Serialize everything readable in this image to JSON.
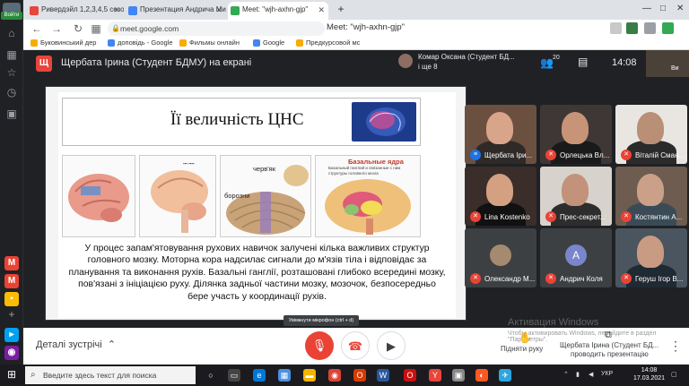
{
  "browser": {
    "login_label": "Войти",
    "tabs": [
      {
        "title": "Ривердэйл 1,2,3,4,5 сезон",
        "fav_color": "#e8453c"
      },
      {
        "title": "Презентация Андрича Ми",
        "fav_color": "#4285f4"
      },
      {
        "title": "Meet: \"wjh-axhn-gjp\"",
        "fav_color": "#34a853"
      }
    ],
    "address": "meet.google.com",
    "page_title": "Meet: \"wjh-axhn-gjp\"",
    "bookmarks": [
      {
        "label": "Буковинський дер",
        "color": "#f9ab00"
      },
      {
        "label": "доповідь - Google",
        "color": "#4285f4"
      },
      {
        "label": "Фильмы онлайн",
        "color": "#f9ab00"
      },
      {
        "label": "Google",
        "color": "#4285f4"
      },
      {
        "label": "Предкурсовой мс",
        "color": "#f9ab00"
      }
    ]
  },
  "meet": {
    "presenter_badge": "Щ",
    "presenter_title": "Щербата Ірина (Студент БДМУ) на екрані",
    "chip_name": "Комар Оксана (Студент БД...",
    "chip_more": "і ще 8",
    "people_count": "20",
    "time": "14:08",
    "self_name": "Ви",
    "mic_tooltip": "Увімкнути мікрофон (ctrl + d)",
    "details_label": "Деталі зустрічі",
    "raise_hand_label": "Підняти руку",
    "presenting_label_1": "Щербата Ірина (Студент БД...",
    "presenting_label_2": "проводить презентацію",
    "activation_title": "Активация Windows",
    "activation_text": "Чтобы активировать Windows, перейдите в раздел \"Параметры\"."
  },
  "slide": {
    "title": "Її величність ЦНС",
    "labels": {
      "worm": "черв'як",
      "furrows": "борозни",
      "basal_title": "Базальные ядра",
      "basal_desc": "Базальный ганглий и связанные с ним структуры головного мозга"
    },
    "body": "У процес запам'ятовування рухових навичок залучені кілька важливих структур головного мозку. Моторна кора надсилає сигнали до м'язів тіла і відповідає за планування та виконання рухів. Базальні ганглії, розташовані глибоко всередині мозку, пов'язані з ініціацією руху. Ділянка задньої частини мозку, мозочок, безпосередньо бере участь у координації рухів."
  },
  "participants": [
    {
      "name": "Щербата Іри...",
      "mic": "on",
      "bg": "#6b5040",
      "skin": "#d9a58a",
      "shirt": "#2f2a28"
    },
    {
      "name": "Орлецька Вл...",
      "mic": "off",
      "bg": "#3f3735",
      "skin": "#c79478",
      "shirt": "#1a1a1a"
    },
    {
      "name": "Віталій Сман...",
      "mic": "off",
      "bg": "#e9e6e2",
      "skin": "#b98f75",
      "shirt": "#2b2b2b"
    },
    {
      "name": "Lina Kostenko",
      "mic": "off",
      "bg": "#3b2d2a",
      "skin": "#d4a082",
      "shirt": "#111111"
    },
    {
      "name": "Прес-секрет...",
      "mic": "off",
      "bg": "#d8d2cc",
      "skin": "#c2937a",
      "shirt": "#2d2d2d"
    },
    {
      "name": "Костянтин А...",
      "mic": "off",
      "bg": "#6d5c4f",
      "skin": "#caa088",
      "shirt": "#3a4b57"
    },
    {
      "name": "Олександр М...",
      "mic": "off",
      "bg": "#3c4043",
      "avatar": "photo"
    },
    {
      "name": "Андрич Коля",
      "mic": "off",
      "bg": "#3c4043",
      "avatar": "А"
    },
    {
      "name": "Геруш Ігор В...",
      "mic": "off",
      "bg": "#4a5560",
      "skin": "#c99b82",
      "shirt": "#1f2a33"
    }
  ],
  "taskbar": {
    "search_placeholder": "Введите здесь текст для поиска",
    "lang": "УКР",
    "time": "14:08",
    "date": "17.03.2021"
  }
}
